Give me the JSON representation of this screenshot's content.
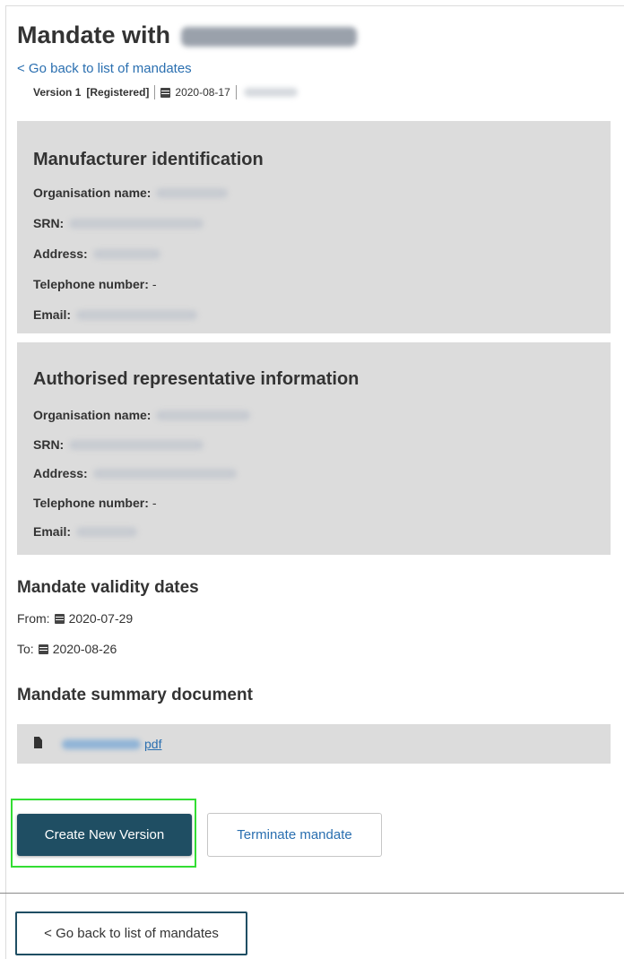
{
  "page": {
    "title_prefix": "Mandate with",
    "back_link": "< Go back to list of mandates"
  },
  "meta": {
    "version": "Version 1",
    "status": "[Registered]",
    "date": "2020-08-17"
  },
  "manufacturer": {
    "heading": "Manufacturer identification",
    "org_label": "Organisation name:",
    "srn_label": "SRN:",
    "address_label": "Address:",
    "phone_label": "Telephone number:",
    "phone_value": "-",
    "email_label": "Email:"
  },
  "authorised": {
    "heading": "Authorised representative information",
    "org_label": "Organisation name:",
    "srn_label": "SRN:",
    "address_label": "Address:",
    "phone_label": "Telephone number:",
    "phone_value": "-",
    "email_label": "Email:"
  },
  "validity": {
    "heading": "Mandate validity dates",
    "from_label": "From:",
    "from_date": "2020-07-29",
    "to_label": "To:",
    "to_date": "2020-08-26"
  },
  "summary": {
    "heading": "Mandate summary document",
    "file_suffix": "pdf"
  },
  "actions": {
    "create_label": "Create New Version",
    "terminate_label": "Terminate mandate",
    "back_label": "< Go back to list of mandates"
  },
  "colors": {
    "primary": "#1f4e63",
    "link": "#2a6fb0",
    "panel": "#dcdcdc",
    "highlight": "#33dd33"
  }
}
